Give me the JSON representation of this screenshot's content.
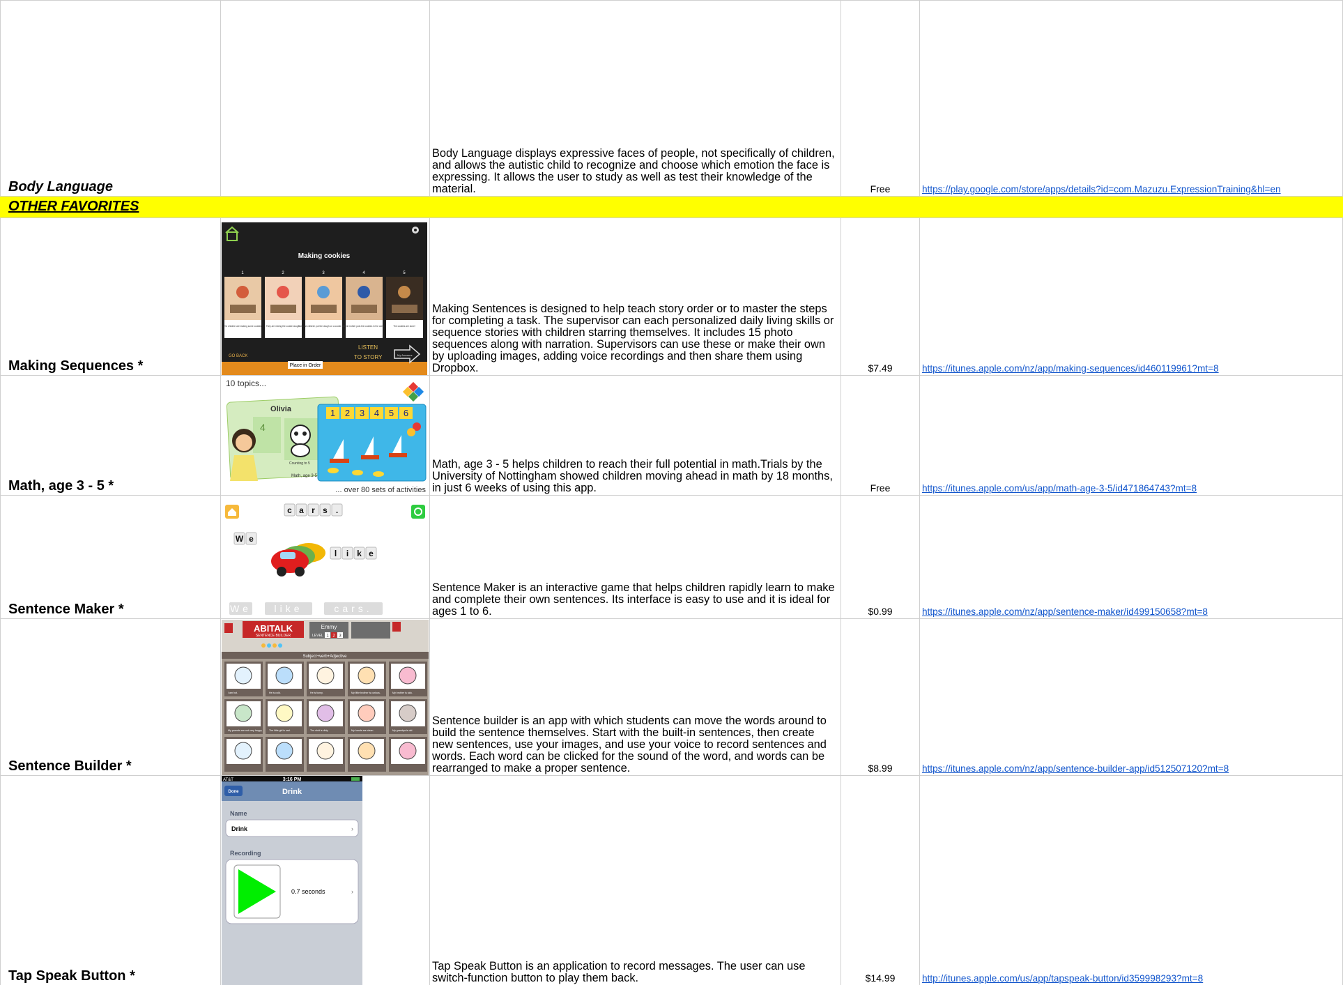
{
  "rows": [
    {
      "name": "Body Language",
      "description": "Body Language displays expressive faces of people, not specifically of children, and allows the autistic child to recognize and choose which emotion the face is expressing. It allows the user to study as well as test their knowledge of the material.",
      "price": "Free",
      "link": "https://play.google.com/store/apps/details?id=com.Mazuzu.ExpressionTraining&hl=en"
    },
    {
      "name": "Making Sequences *",
      "description": "Making Sentences is designed to help teach story order or to master the steps for completing a task. The supervisor can each personalized daily living skills or sequence stories with children starring themselves. It includes 15 photo sequences along with narration. Supervisors can use these or make their own by uploading images, adding voice recordings and then share them using Dropbox.",
      "price": "$7.49",
      "link": "https://itunes.apple.com/nz/app/making-sequences/id460119961?mt=8",
      "screenshot": {
        "title": "Making cookies",
        "steps": [
          "1",
          "2",
          "3",
          "4",
          "5"
        ],
        "captions": [
          "The children are making some cookies",
          "They are mixing the cookie dough.",
          "Now the children put the dough on a cookie sheet.",
          "Their mother puts the cookies in the oven.",
          "The cookies are done!"
        ],
        "go_back": "GO BACK",
        "place_in_order": "Place in Order",
        "listen": "LISTEN",
        "to_story": "TO STORY",
        "my_answers": "My Answers"
      }
    },
    {
      "name": "Math, age 3 - 5 *",
      "description": "Math, age 3 - 5 helps children to reach their full potential in math.Trials by the University of Nottingham showed children moving ahead in math by 18 months, in just 6 weeks of using this app.",
      "price": "Free",
      "link": "https://itunes.apple.com/us/app/math-age-3-5/id471864743?mt=8",
      "screenshot": {
        "topics": "10 topics...",
        "child_name": "Olivia",
        "numbers": [
          "1",
          "2",
          "3",
          "4",
          "5",
          "6"
        ],
        "card_numbers": [
          "4",
          "5"
        ],
        "card_caption": "Counting to 5",
        "app_label": "Math, age 3-5",
        "footer": "... over 80 sets of activities"
      }
    },
    {
      "name": "Sentence Maker *",
      "description": "Sentence Maker is an interactive game that helps children rapidly learn to make and complete their own sentences. Its interface is easy to use and it is ideal for ages 1 to 6.",
      "price": "$0.99",
      "link": "https://itunes.apple.com/nz/app/sentence-maker/id499150658?mt=8",
      "screenshot": {
        "cars_tiles": [
          "c",
          "a",
          "r",
          "s",
          "."
        ],
        "we_tiles": [
          "W",
          "e"
        ],
        "like_tiles": [
          "l",
          "i",
          "k",
          "e"
        ],
        "slot_words": [
          "We",
          "like",
          "cars."
        ]
      }
    },
    {
      "name": "Sentence Builder *",
      "description": "Sentence builder is an app with which students can move the words around to build the sentence themselves. Start with the built-in sentences, then create new sentences, use your images, and use your voice to record sentences and words. Each word can be clicked for the sound of the word, and words can be rearranged to make a proper sentence.",
      "price": "$8.99",
      "link": "https://itunes.apple.com/nz/app/sentence-builder-app/id512507120?mt=8",
      "screenshot": {
        "logo": "ABITALK",
        "logo_sub": "SENTENCE BUILDER",
        "user": "Emmy",
        "level_label": "LEVEL",
        "levels": [
          "1",
          "2",
          "3"
        ],
        "structure": "Subject+verb+Adjective",
        "captions": [
          "I am hot.",
          "He is cold.",
          "He is funny.",
          "My little brother is curious.",
          "My brother is sick.",
          "My parents are not very happy.",
          "The little girl is sad.",
          "The shirt is dirty.",
          "My hands are clean.",
          "My grandpa is old."
        ]
      }
    },
    {
      "name": "Tap Speak Button *",
      "description": "Tap Speak Button is an application to record messages. The user can use switch-function button to play them back.",
      "price": "$14.99",
      "link": "http://itunes.apple.com/us/app/tapspeak-button/id359998293?mt=8",
      "screenshot": {
        "carrier": "AT&T",
        "time": "3:16 PM",
        "done": "Done",
        "title": "Drink",
        "name_label": "Name",
        "name_value": "Drink",
        "recording_label": "Recording",
        "recording_value": "0.7 seconds"
      }
    }
  ],
  "category_banner": "OTHER FAVORITES",
  "colors": {
    "banner": "#ffff00",
    "link": "#1155cc",
    "grid": "#cfcfcf"
  }
}
